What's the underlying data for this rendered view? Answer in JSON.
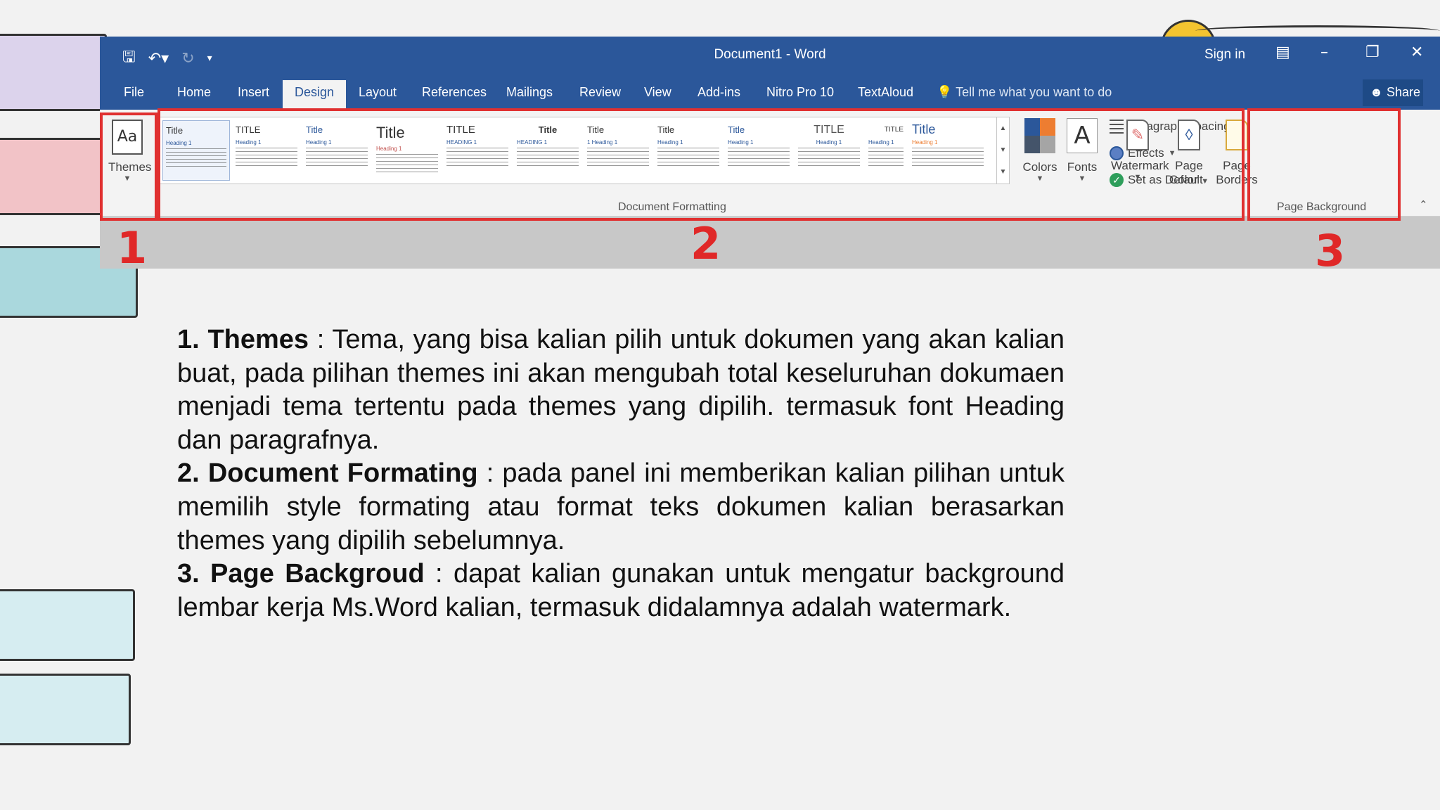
{
  "window": {
    "title": "Document1  -  Word",
    "sign_in": "Sign in",
    "qat_icons": [
      "save-icon",
      "undo-icon",
      "redo-icon",
      "customize-qat-icon"
    ]
  },
  "tabs": {
    "file": "File",
    "home": "Home",
    "insert": "Insert",
    "design": "Design",
    "layout": "Layout",
    "references": "References",
    "mailings": "Mailings",
    "review": "Review",
    "view": "View",
    "addins": "Add-ins",
    "nitro": "Nitro Pro 10",
    "textaloud": "TextAloud",
    "tellme": "Tell me what you want to do",
    "share": "Share",
    "active": "Design"
  },
  "ribbon": {
    "themes_label": "Themes",
    "theme_icon_text": "Aa",
    "document_formatting_label": "Document Formatting",
    "styles": [
      {
        "title": "Title",
        "heading": "Heading 1"
      },
      {
        "title": "TITLE",
        "heading": "Heading 1"
      },
      {
        "title": "Title",
        "heading": "Heading 1"
      },
      {
        "title": "Title",
        "heading": "Heading 1"
      },
      {
        "title": "TITLE",
        "heading": "HEADING 1"
      },
      {
        "title": "Title",
        "heading": "HEADING 1"
      },
      {
        "title": "Title",
        "heading": "1 Heading 1"
      },
      {
        "title": "Title",
        "heading": "Heading 1"
      },
      {
        "title": "Title",
        "heading": "Heading 1"
      },
      {
        "title": "TITLE",
        "heading": "Heading 1"
      },
      {
        "title": "TITLE",
        "heading": "Heading 1"
      },
      {
        "title": "Title",
        "heading": "Heading 1"
      }
    ],
    "colors_label": "Colors",
    "fonts_label": "Fonts",
    "fonts_icon_text": "A",
    "paragraph_spacing_label": "Paragraph Spacing",
    "effects_label": "Effects",
    "set_as_default_label": "Set as Default",
    "watermark_label": "Watermark",
    "page_color_label_1": "Page",
    "page_color_label_2": "Color",
    "page_borders_label_1": "Page",
    "page_borders_label_2": "Borders",
    "page_background_label": "Page Background"
  },
  "colors": {
    "title_bar": "#2b579a",
    "annotation_red": "#e03030",
    "theme_swatches": [
      "#2b579a",
      "#ed7d31",
      "#44546a",
      "#a5a5a5"
    ]
  },
  "annotations": {
    "n1": "1",
    "n2": "2",
    "n3": "3"
  },
  "description": {
    "p1_lead": "1. Themes",
    "p1_text": " : Tema, yang bisa kalian pilih untuk dokumen yang akan kalian buat, pada pilihan themes ini akan mengubah total keseluruhan dokumaen menjadi tema tertentu pada themes yang dipilih. termasuk font Heading dan paragrafnya.",
    "p2_lead": "2. Document Formating",
    "p2_text": " : pada panel ini memberikan kalian pilihan untuk memilih style formating atau format teks dokumen kalian berasarkan themes yang dipilih sebelumnya.",
    "p3_lead": "3. Page Backgroud",
    "p3_text": " : dapat kalian gunakan untuk mengatur background lembar kerja Ms.Word kalian, termasuk didalamnya adalah watermark."
  }
}
